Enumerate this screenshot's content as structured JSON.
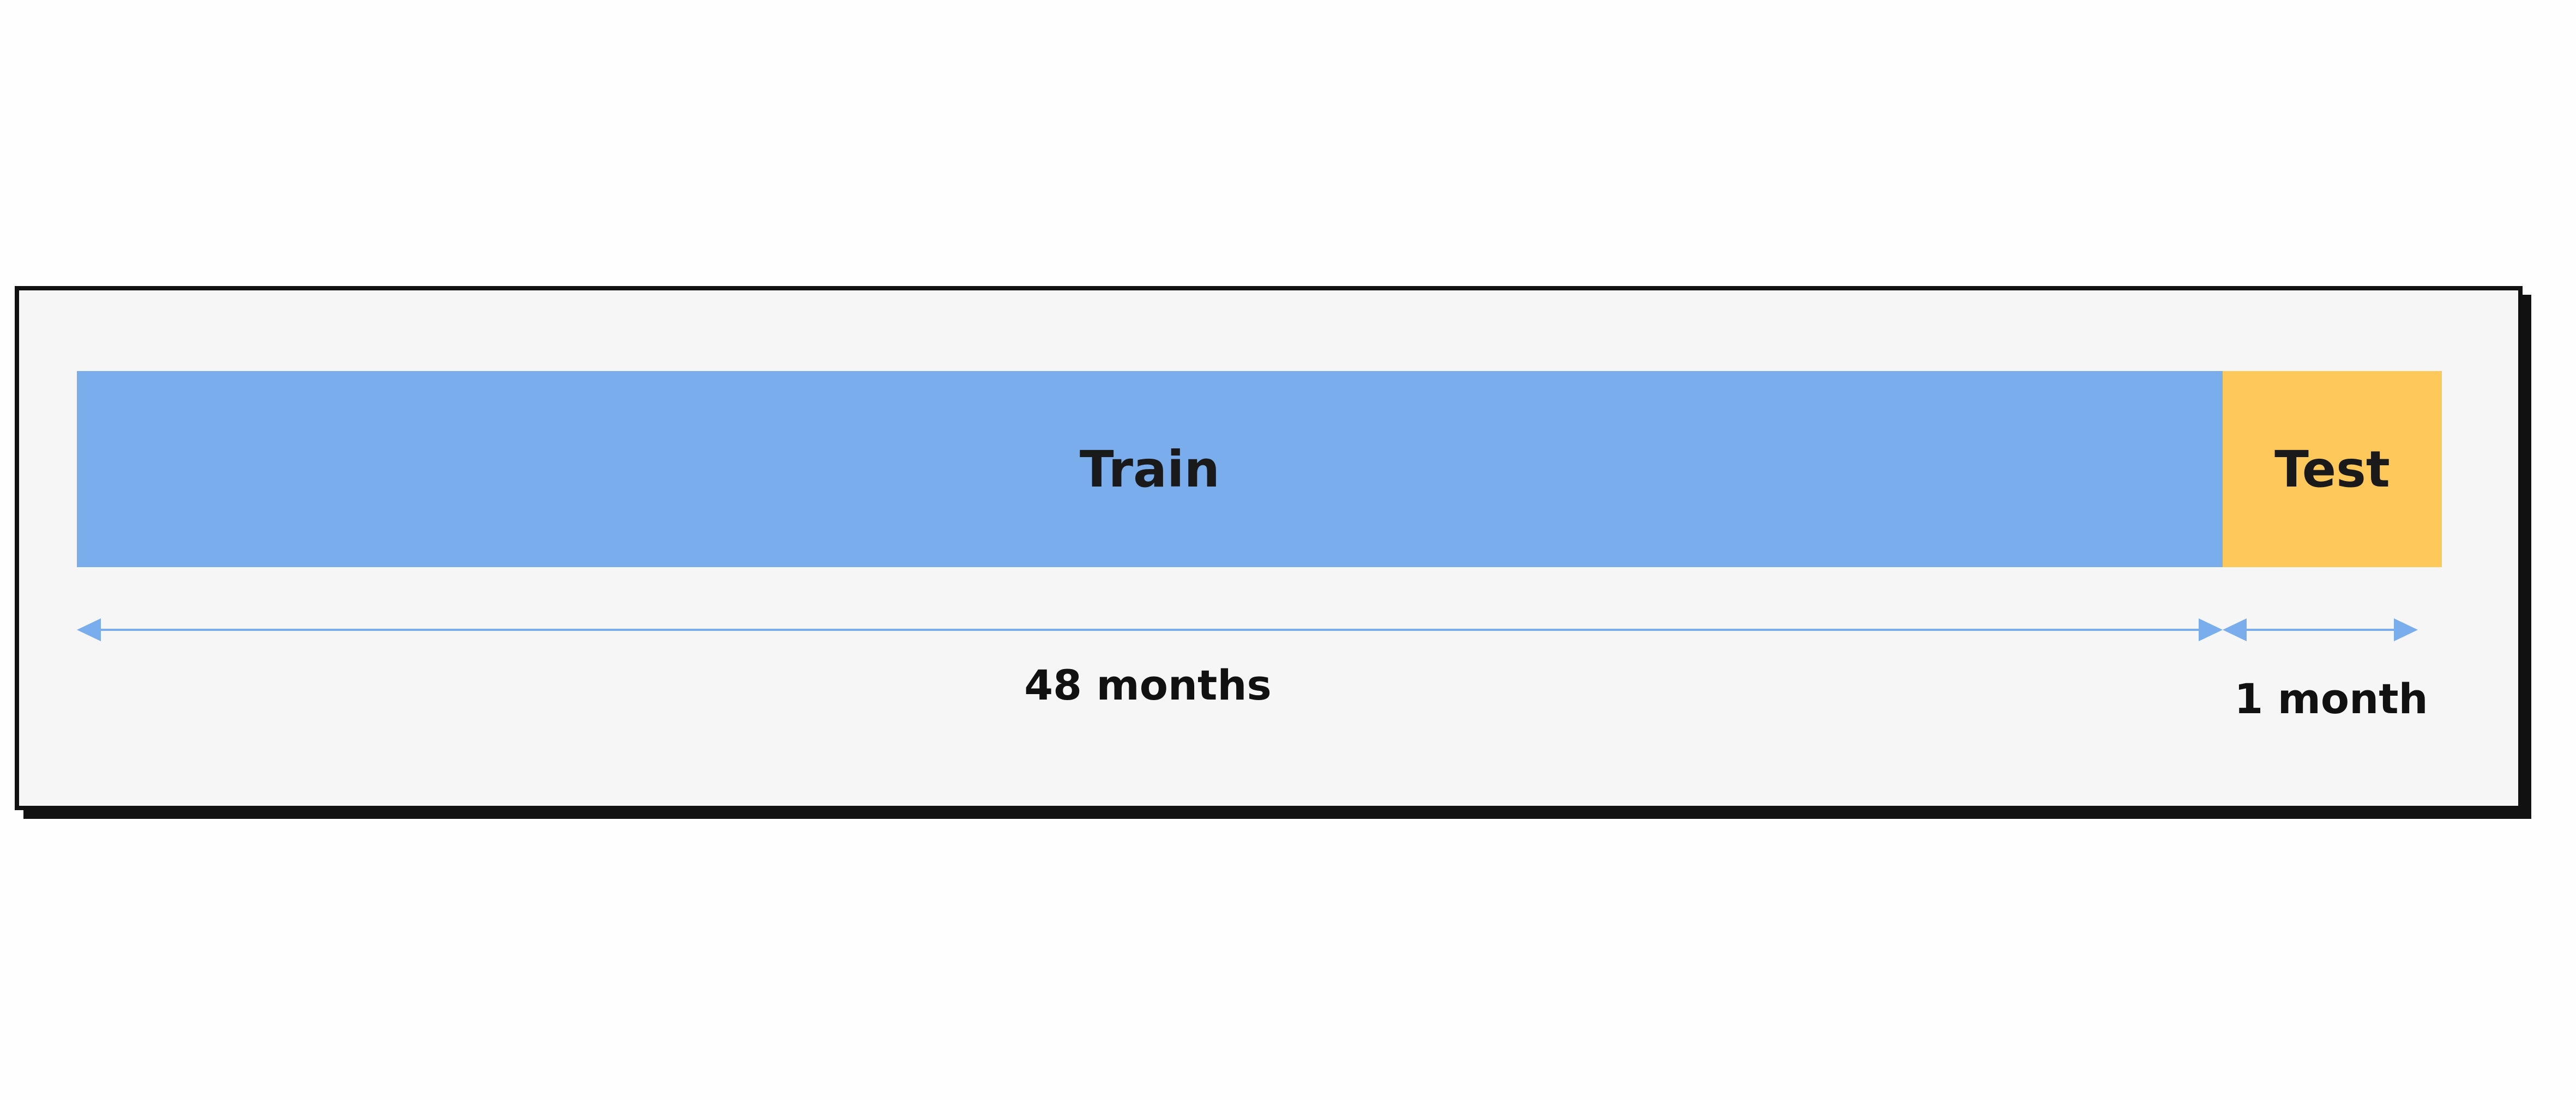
{
  "segments": {
    "train": {
      "label": "Train",
      "duration": "48 months",
      "color": "#7aadec"
    },
    "test": {
      "label": "Test",
      "duration": "1 month",
      "color": "#fec85a"
    }
  },
  "arrow_color": "#7aadec"
}
